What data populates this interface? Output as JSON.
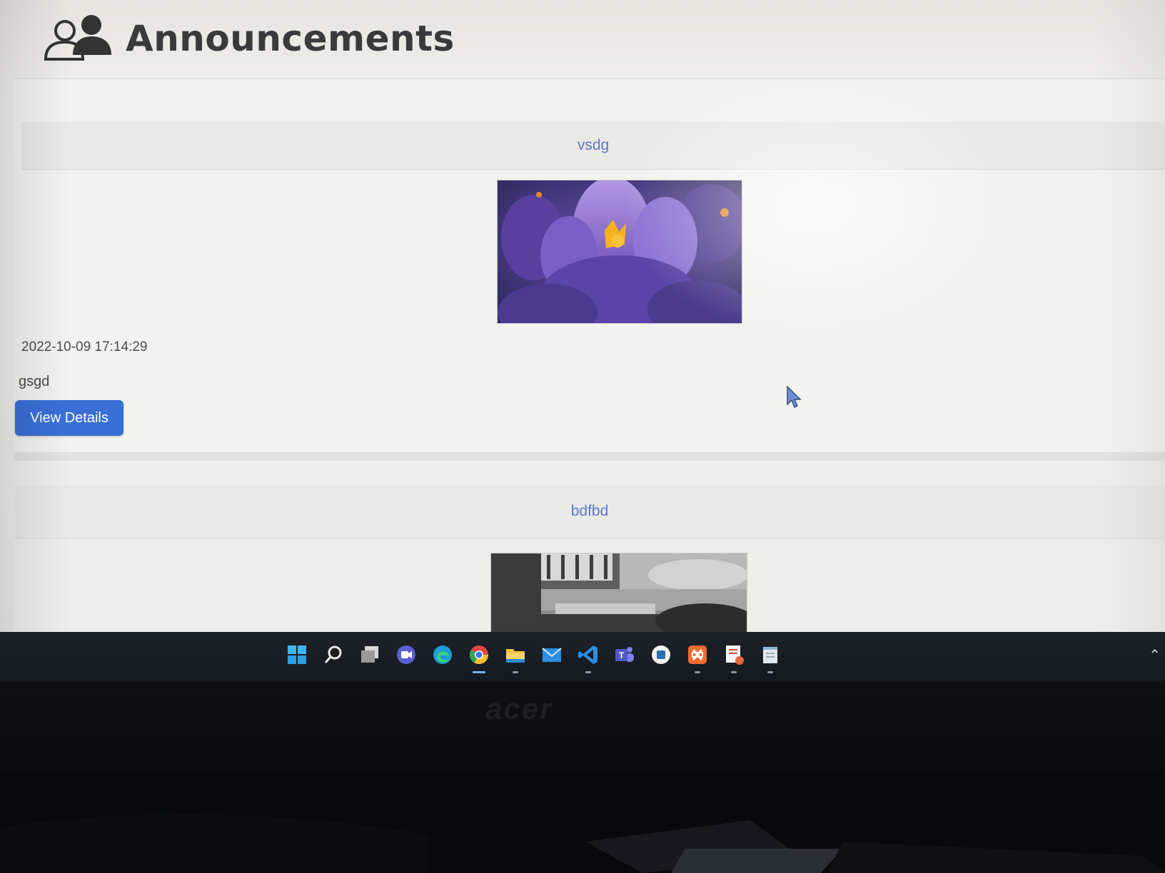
{
  "page": {
    "title": "Announcements",
    "header_icon": "users-icon"
  },
  "announcements": [
    {
      "title": "vsdg",
      "image": "purple-crocus-photo",
      "timestamp": "2022-10-09 17:14:29",
      "excerpt": "gsgd",
      "button_label": "View Details"
    },
    {
      "title": "bdfbd",
      "image": "grayscale-building-photo"
    }
  ],
  "taskbar": {
    "icons": [
      "windows-start-icon",
      "search-icon",
      "task-view-icon",
      "video-chat-icon",
      "edge-icon",
      "chrome-icon",
      "file-explorer-icon",
      "mail-icon",
      "vscode-icon",
      "teams-icon",
      "circle-app-icon",
      "xampp-icon",
      "document-app-icon",
      "notepad-icon"
    ]
  },
  "monitor": {
    "brand": "acer"
  },
  "colors": {
    "accent": "#3a6fd7",
    "card_title": "#5d78c8"
  }
}
